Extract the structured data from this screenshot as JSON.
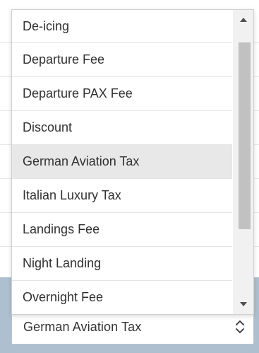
{
  "dropdown": {
    "options": [
      {
        "label": "De-icing"
      },
      {
        "label": "Departure Fee"
      },
      {
        "label": "Departure PAX Fee"
      },
      {
        "label": "Discount"
      },
      {
        "label": "German Aviation Tax"
      },
      {
        "label": "Italian Luxury Tax"
      },
      {
        "label": "Landings Fee"
      },
      {
        "label": "Night Landing"
      },
      {
        "label": "Overnight Fee"
      }
    ],
    "highlighted_option": "German Aviation Tax"
  },
  "select": {
    "value": "German Aviation Tax"
  },
  "colors": {
    "highlight": "#e8e8e8",
    "background_band": "#aebfd0",
    "scrollbar_thumb": "#c1c1c1"
  },
  "icons": {
    "scroll_up": "caret-up-icon",
    "scroll_down": "caret-down-icon",
    "select_toggle": "up-down-chevrons-icon"
  }
}
